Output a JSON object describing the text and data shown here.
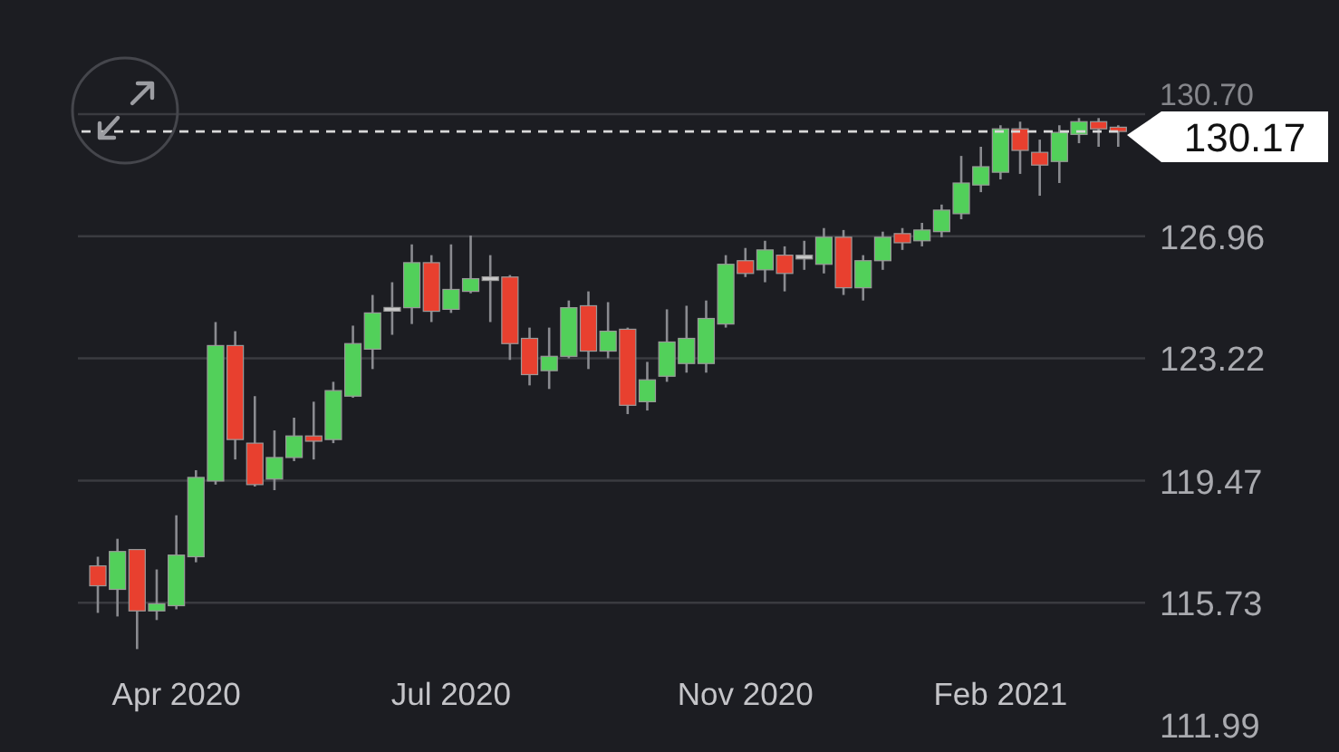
{
  "chart": {
    "chart_data": {
      "type": "candlestick",
      "grid": true,
      "ref_lines": [
        {
          "axis": "y",
          "value": 130.17,
          "label": "130.17"
        }
      ],
      "categories": [
        null,
        null,
        null,
        null,
        "Apr 2020",
        null,
        null,
        null,
        null,
        null,
        null,
        null,
        null,
        null,
        null,
        null,
        null,
        null,
        "Jul 2020",
        null,
        null,
        null,
        null,
        null,
        null,
        null,
        null,
        null,
        null,
        null,
        null,
        null,
        null,
        "Nov 2020",
        null,
        null,
        null,
        null,
        null,
        null,
        null,
        null,
        null,
        null,
        null,
        null,
        "Feb 2021",
        null,
        null,
        null,
        null,
        null,
        null
      ],
      "ohlc": [
        [
          116.86,
          117.14,
          115.42,
          116.25
        ],
        [
          116.14,
          117.69,
          115.31,
          117.3
        ],
        [
          117.36,
          117.36,
          114.31,
          115.48
        ],
        [
          115.48,
          116.75,
          115.2,
          115.7
        ],
        [
          115.64,
          118.41,
          115.53,
          117.19
        ],
        [
          117.14,
          119.79,
          116.97,
          119.57
        ],
        [
          119.46,
          124.33,
          119.35,
          123.61
        ],
        [
          123.61,
          124.05,
          120.12,
          120.73
        ],
        [
          120.62,
          122.06,
          119.29,
          119.35
        ],
        [
          119.52,
          121.01,
          119.18,
          120.18
        ],
        [
          120.18,
          121.4,
          120.07,
          120.84
        ],
        [
          120.84,
          121.89,
          120.12,
          120.68
        ],
        [
          120.73,
          122.5,
          120.62,
          122.23
        ],
        [
          122.06,
          124.22,
          122.01,
          123.67
        ],
        [
          123.5,
          125.16,
          122.89,
          124.61
        ],
        [
          124.72,
          125.55,
          123.94,
          124.72
        ],
        [
          124.77,
          126.71,
          124.27,
          126.15
        ],
        [
          126.15,
          126.38,
          124.33,
          124.66
        ],
        [
          124.72,
          126.71,
          124.61,
          125.33
        ],
        [
          125.27,
          126.98,
          125.21,
          125.66
        ],
        [
          125.66,
          126.38,
          124.33,
          125.66
        ],
        [
          125.71,
          125.77,
          123.17,
          123.67
        ],
        [
          123.83,
          124.16,
          122.39,
          122.72
        ],
        [
          122.84,
          124.16,
          122.28,
          123.28
        ],
        [
          123.28,
          124.99,
          123.22,
          124.77
        ],
        [
          124.83,
          125.27,
          122.89,
          123.44
        ],
        [
          123.44,
          124.94,
          123.22,
          124.05
        ],
        [
          124.11,
          124.16,
          121.51,
          121.78
        ],
        [
          121.89,
          123.11,
          121.62,
          122.56
        ],
        [
          122.67,
          124.72,
          122.5,
          123.72
        ],
        [
          123.06,
          124.83,
          122.78,
          123.83
        ],
        [
          123.06,
          124.99,
          122.78,
          124.44
        ],
        [
          124.27,
          126.38,
          124.16,
          126.1
        ],
        [
          126.21,
          126.6,
          125.71,
          125.82
        ],
        [
          125.93,
          126.82,
          125.55,
          126.54
        ],
        [
          126.38,
          126.65,
          125.27,
          125.82
        ],
        [
          126.32,
          126.82,
          125.93,
          126.32
        ],
        [
          126.1,
          127.21,
          125.82,
          126.93
        ],
        [
          126.93,
          127.15,
          125.16,
          125.38
        ],
        [
          125.38,
          126.38,
          124.99,
          126.21
        ],
        [
          126.21,
          127.1,
          125.93,
          126.93
        ],
        [
          127.04,
          127.21,
          126.54,
          126.76
        ],
        [
          126.82,
          127.37,
          126.65,
          127.15
        ],
        [
          127.1,
          127.93,
          126.93,
          127.76
        ],
        [
          127.65,
          129.42,
          127.48,
          128.59
        ],
        [
          128.53,
          129.7,
          128.31,
          129.09
        ],
        [
          128.92,
          130.36,
          128.7,
          130.25
        ],
        [
          130.25,
          130.47,
          128.87,
          129.59
        ],
        [
          129.53,
          129.92,
          128.2,
          129.14
        ],
        [
          129.25,
          130.36,
          128.59,
          130.14
        ],
        [
          130.08,
          130.58,
          129.81,
          130.47
        ],
        [
          130.47,
          130.58,
          129.7,
          130.25
        ],
        [
          130.3,
          130.36,
          129.7,
          130.17
        ]
      ],
      "ylim": [
        111.99,
        130.7
      ],
      "yticks": [
        {
          "value": 130.7,
          "label": "130.70"
        },
        {
          "value": 126.96,
          "label": "126.96"
        },
        {
          "value": 123.22,
          "label": "123.22"
        },
        {
          "value": 119.47,
          "label": "119.47"
        },
        {
          "value": 115.73,
          "label": "115.73"
        },
        {
          "value": 111.99,
          "label": "111.99"
        }
      ]
    }
  }
}
